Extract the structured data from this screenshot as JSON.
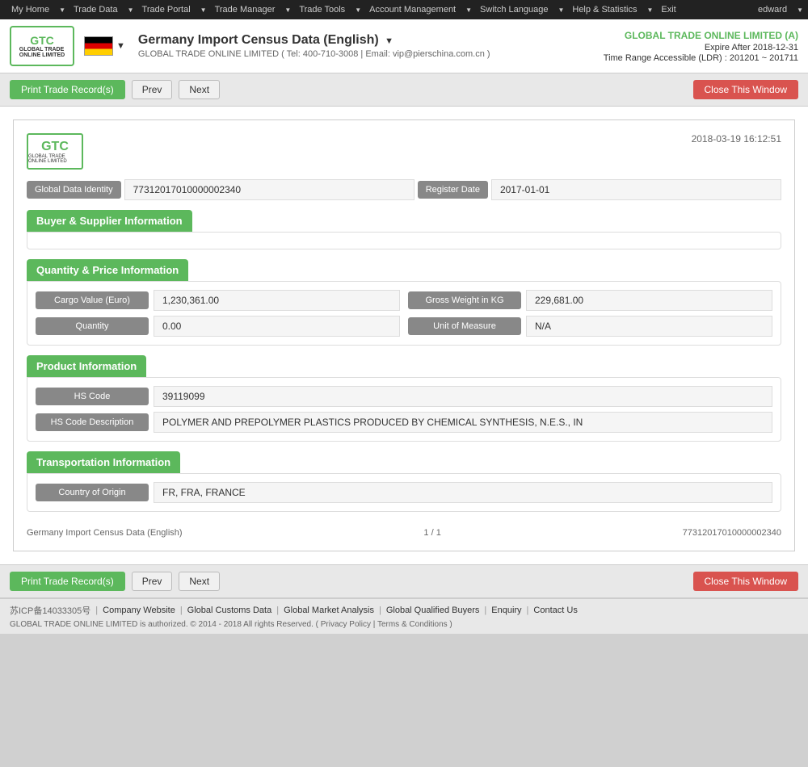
{
  "topnav": {
    "items": [
      {
        "label": "My Home",
        "id": "my-home"
      },
      {
        "label": "Trade Data",
        "id": "trade-data"
      },
      {
        "label": "Trade Portal",
        "id": "trade-portal"
      },
      {
        "label": "Trade Manager",
        "id": "trade-manager"
      },
      {
        "label": "Trade Tools",
        "id": "trade-tools"
      },
      {
        "label": "Account Management",
        "id": "account-mgmt"
      },
      {
        "label": "Switch Language",
        "id": "switch-lang"
      },
      {
        "label": "Help & Statistics",
        "id": "help-stats"
      },
      {
        "label": "Exit",
        "id": "exit"
      }
    ],
    "user": "edward"
  },
  "header": {
    "logo_text": "GTC",
    "logo_sub": "GLOBAL TRADE ONLINE LIMITED",
    "page_title": "Germany Import Census Data (English)",
    "company_info": "GLOBAL TRADE ONLINE LIMITED ( Tel: 400-710-3008  |  Email: vip@pierschina.com.cn )",
    "company_link": "GLOBAL TRADE ONLINE LIMITED (A)",
    "expire": "Expire After 2018-12-31",
    "time_range": "Time Range Accessible (LDR) : 201201 ~ 201711"
  },
  "toolbar": {
    "print_label": "Print Trade Record(s)",
    "prev_label": "Prev",
    "next_label": "Next",
    "close_label": "Close This Window"
  },
  "record": {
    "timestamp": "2018-03-19 16:12:51",
    "global_data_identity_label": "Global Data Identity",
    "global_data_identity_value": "77312017010000002340",
    "register_date_label": "Register Date",
    "register_date_value": "2017-01-01",
    "sections": {
      "buyer_supplier": {
        "title": "Buyer & Supplier Information",
        "fields": []
      },
      "quantity_price": {
        "title": "Quantity & Price Information",
        "fields": [
          {
            "label": "Cargo Value (Euro)",
            "value": "1,230,361.00"
          },
          {
            "label": "Gross Weight in KG",
            "value": "229,681.00"
          },
          {
            "label": "Quantity",
            "value": "0.00"
          },
          {
            "label": "Unit of Measure",
            "value": "N/A"
          }
        ]
      },
      "product": {
        "title": "Product Information",
        "fields": [
          {
            "label": "HS Code",
            "value": "39119099"
          },
          {
            "label": "HS Code Description",
            "value": "POLYMER AND PREPOLYMER PLASTICS PRODUCED BY CHEMICAL SYNTHESIS, N.E.S., IN"
          }
        ]
      },
      "transportation": {
        "title": "Transportation Information",
        "fields": [
          {
            "label": "Country of Origin",
            "value": "FR, FRA, FRANCE"
          }
        ]
      }
    },
    "footer": {
      "title": "Germany Import Census Data (English)",
      "page": "1 / 1",
      "id": "77312017010000002340"
    }
  },
  "footer": {
    "icp": "苏ICP备14033305号",
    "links": [
      "Company Website",
      "Global Customs Data",
      "Global Market Analysis",
      "Global Qualified Buyers",
      "Enquiry",
      "Contact Us"
    ],
    "copyright": "GLOBAL TRADE ONLINE LIMITED is authorized. © 2014 - 2018 All rights Reserved.  (  Privacy Policy  |  Terms & Conditions  )"
  }
}
